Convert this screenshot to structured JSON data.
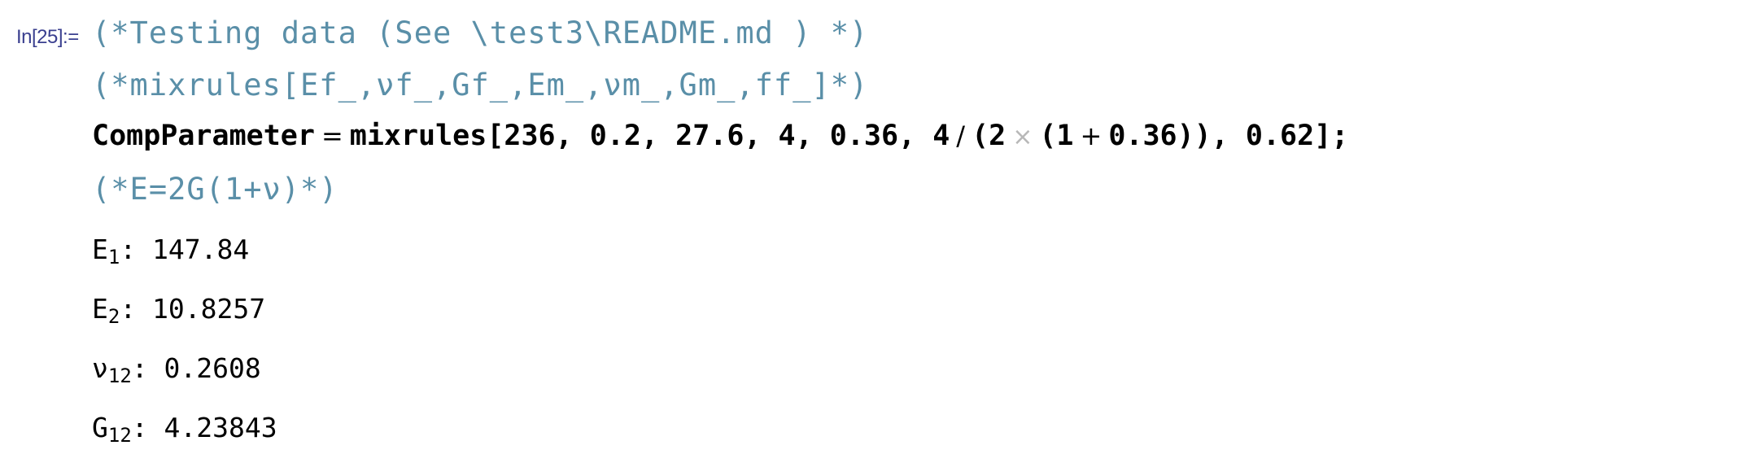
{
  "cell": {
    "label": "In[25]:=",
    "comment_lines": [
      "(*Testing data (See \\test3\\README.md ) *)",
      "(*mixrules[Ef_,νf_,Gf_,Em_,νm_,Gm_,ff_]*)"
    ],
    "code": {
      "assign_name": "CompParameter",
      "equals": "=",
      "func": "mixrules",
      "args_prefix": "[236, 0.2, 27.6, 4, 0.36, 4",
      "divide": "/",
      "paren_open": "(2",
      "times": "×",
      "paren_inner": "(1",
      "plus": "+",
      "args_suffix": "0.36)), 0.62];"
    },
    "comment_after": "(*E=2G(1+ν)*)",
    "outputs": [
      {
        "symbol": "E",
        "sub": "1",
        "value": ": 147.84"
      },
      {
        "symbol": "E",
        "sub": "2",
        "value": ": 10.8257"
      },
      {
        "symbol": "ν",
        "sub": "12",
        "value": ": 0.2608"
      },
      {
        "symbol": "G",
        "sub": "12",
        "value": ": 4.23843"
      }
    ]
  },
  "colors": {
    "label": "#3a3f8f",
    "comment": "#5a8fa8",
    "code": "#000000",
    "times_symbol": "#b8b8b8"
  }
}
